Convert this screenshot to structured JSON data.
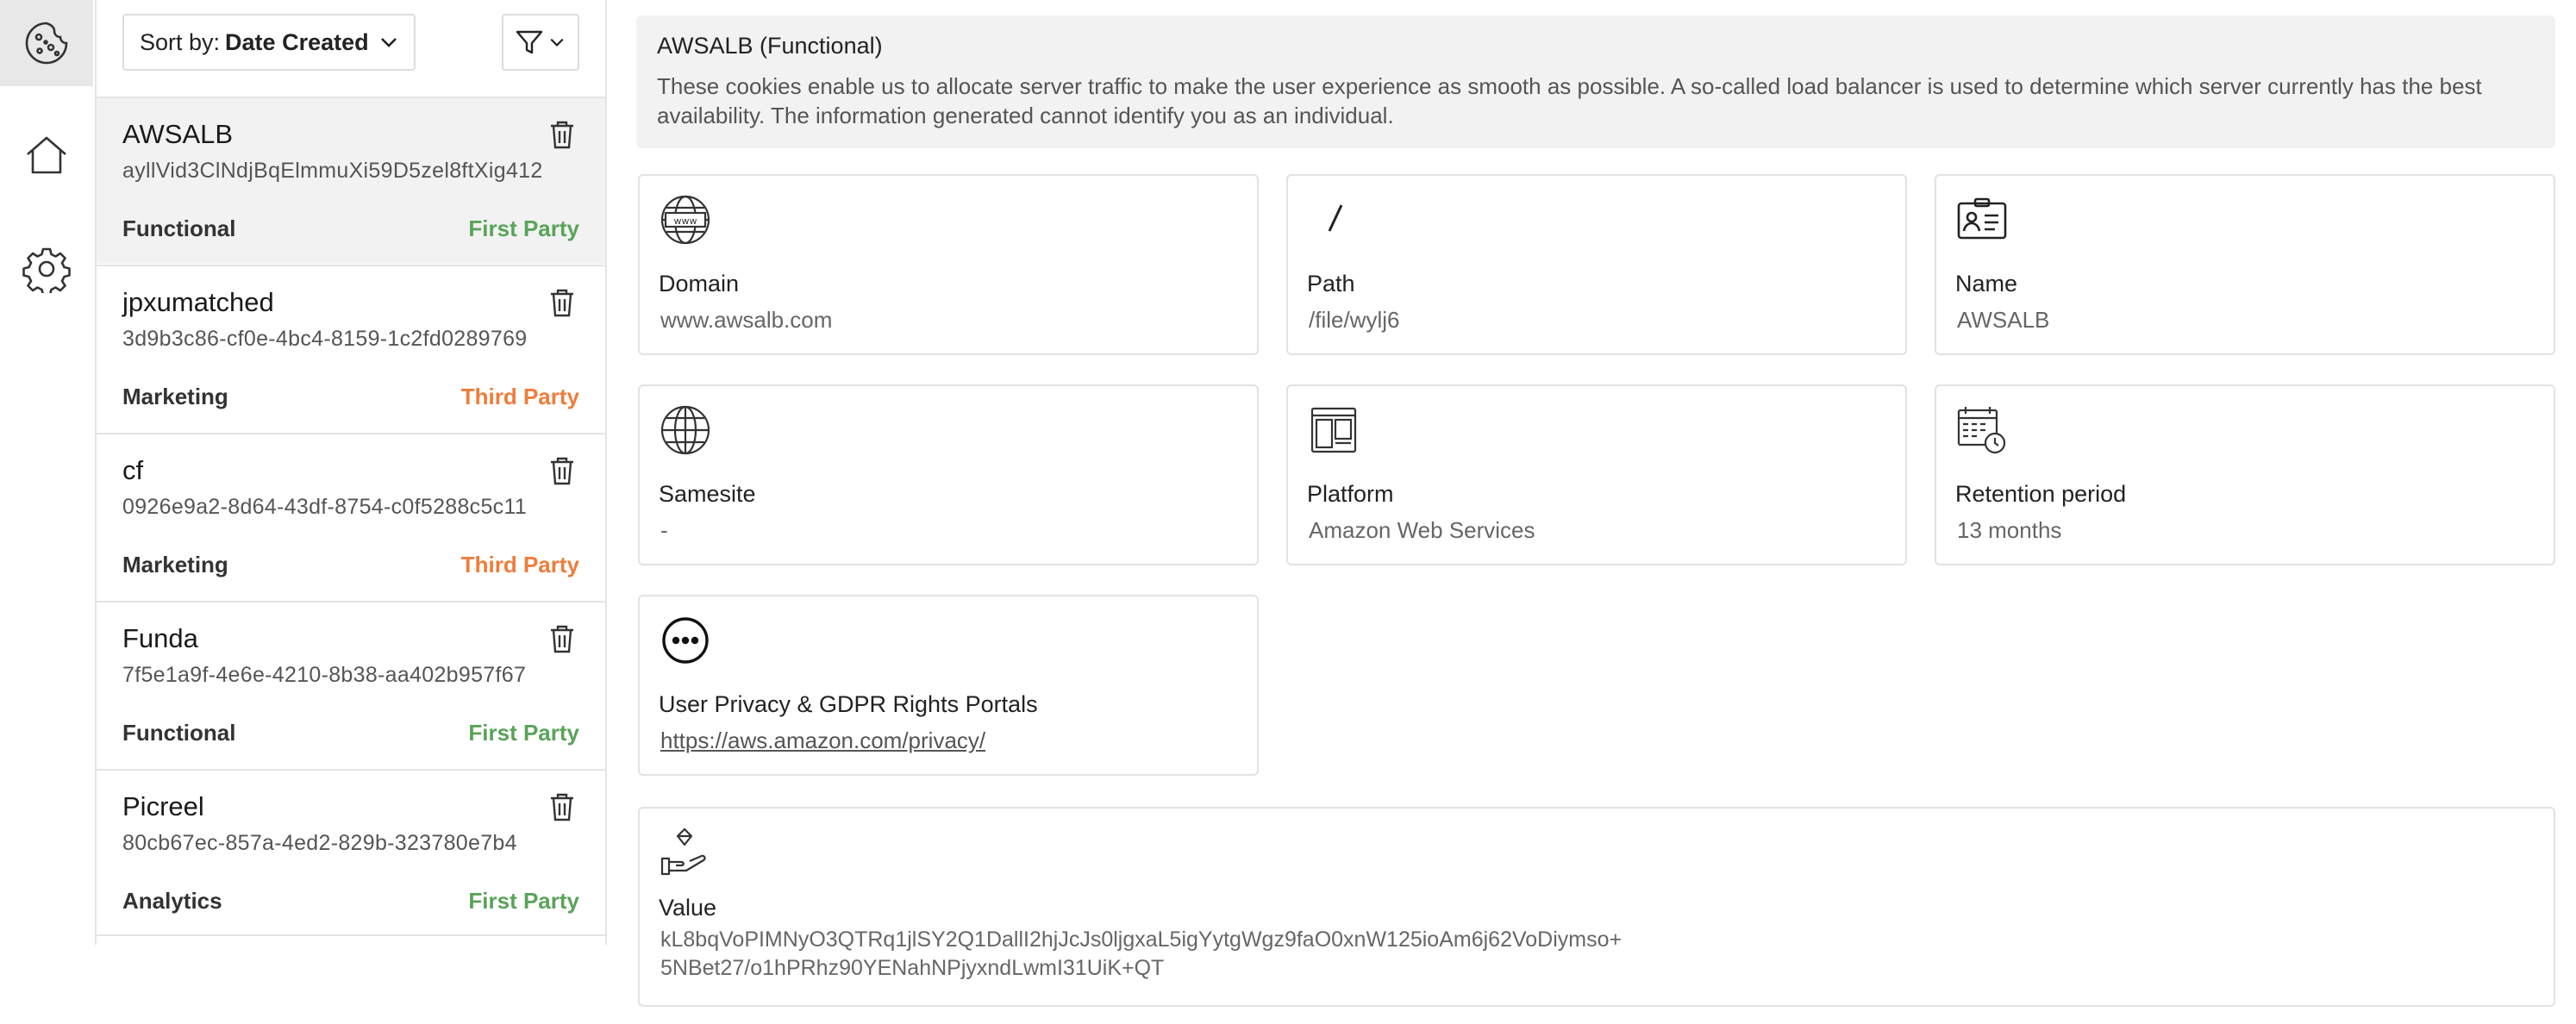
{
  "rail": {
    "items": [
      {
        "icon": "cookie-icon",
        "active": true
      },
      {
        "icon": "home-icon",
        "active": false
      },
      {
        "icon": "gear-icon",
        "active": false
      }
    ]
  },
  "toolbar": {
    "sort_prefix": "Sort by:",
    "sort_value": "Date Created"
  },
  "cookies": [
    {
      "name": "AWSALB",
      "id": "ayllVid3ClNdjBqElmmuXi59D5zel8ftXig412",
      "category": "Functional",
      "party": "First Party",
      "party_type": "first"
    },
    {
      "name": "jpxumatched",
      "id": "3d9b3c86-cf0e-4bc4-8159-1c2fd0289769",
      "category": "Marketing",
      "party": "Third Party",
      "party_type": "third"
    },
    {
      "name": "cf",
      "id": "0926e9a2-8d64-43df-8754-c0f5288c5c11",
      "category": "Marketing",
      "party": "Third Party",
      "party_type": "third"
    },
    {
      "name": "Funda",
      "id": "7f5e1a9f-4e6e-4210-8b38-aa402b957f67",
      "category": "Functional",
      "party": "First Party",
      "party_type": "first"
    },
    {
      "name": "Picreel",
      "id": "80cb67ec-857a-4ed2-829b-323780e7b4",
      "category": "Analytics",
      "party": "First Party",
      "party_type": "first"
    }
  ],
  "detail": {
    "title": "AWSALB (Functional)",
    "description": "These cookies enable us to allocate server traffic to make the user experience as smooth as possible. A so-called load balancer is used to determine which server currently has the best availability. The information generated cannot identify you as an individual.",
    "domain_label": "Domain",
    "domain_value": "www.awsalb.com",
    "path_label": "Path",
    "path_value": "/file/wylj6",
    "name_label": "Name",
    "name_value": "AWSALB",
    "samesite_label": "Samesite",
    "samesite_value": "-",
    "platform_label": "Platform",
    "platform_value": "Amazon Web Services",
    "retention_label": "Retention period",
    "retention_value": "13 months",
    "privacy_label": "User Privacy & GDPR Rights Portals",
    "privacy_link": "https://aws.amazon.com/privacy/",
    "value_label": "Value",
    "value_line1": "kL8bqVoPIMNyO3QTRq1jlSY2Q1DallI2hjJcJs0ljgxaL5igYytgWgz9faO0xnW125ioAm6j62VoDiymso+",
    "value_line2": "5NBet27/o1hPRhz90YENahNPjyxndLwmI31UiK+QT"
  },
  "colors": {
    "first_party": "#5aa35a",
    "third_party": "#ef7d3a",
    "selected_bg": "#f2f2f2"
  }
}
